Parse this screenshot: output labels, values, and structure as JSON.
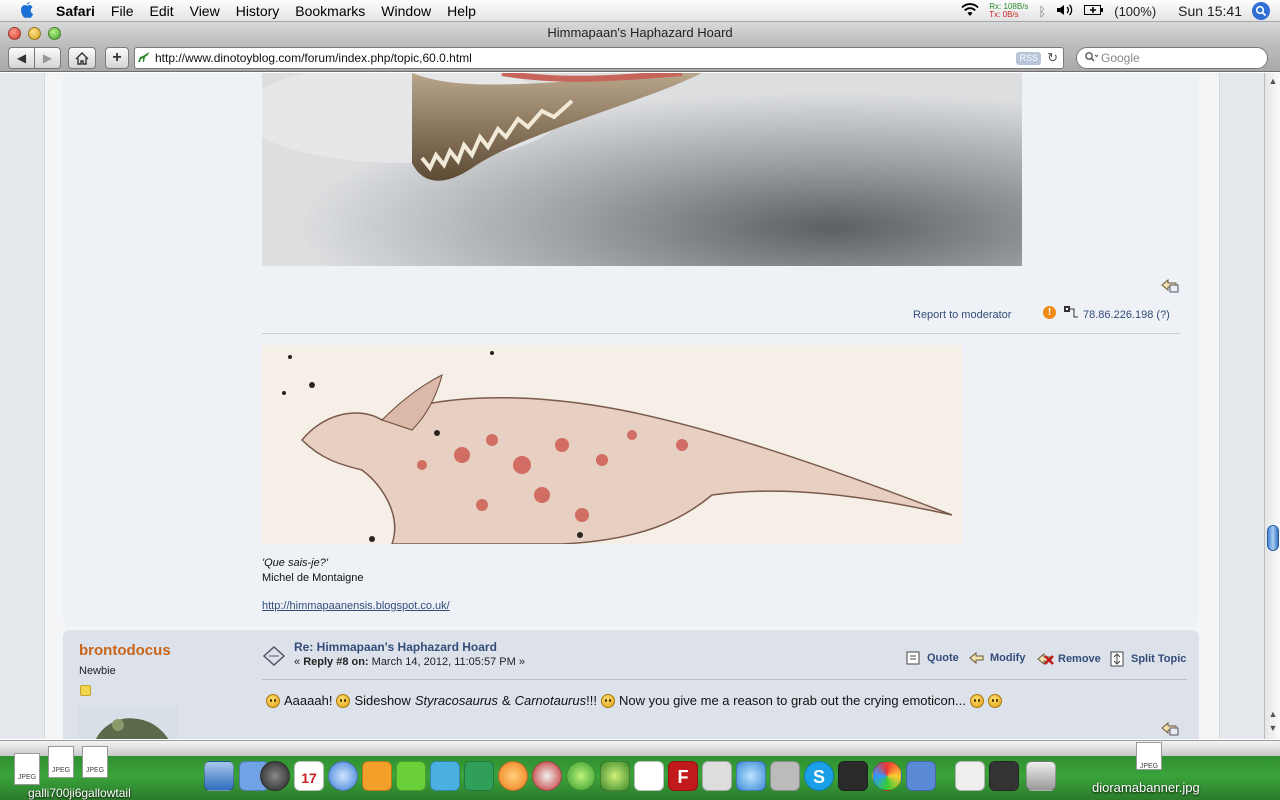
{
  "menubar": {
    "app": "Safari",
    "items": [
      "File",
      "Edit",
      "View",
      "History",
      "Bookmarks",
      "Window",
      "Help"
    ],
    "net_rx_label": "Rx:",
    "net_rx_value": "108B/s",
    "net_tx_label": "Tx:",
    "net_tx_value": "0B/s",
    "battery": "(100%)",
    "clock": "Sun 15:41"
  },
  "window": {
    "title": "Himmapaan's Haphazard Hoard",
    "url": "http://www.dinotoyblog.com/forum/index.php/topic,60.0.html",
    "rss_label": "RSS",
    "search_placeholder": "Google"
  },
  "post1": {
    "report_label": "Report to moderator",
    "ip": "78.86.226.198 (?)",
    "sig_quote": "'Que sais-je?'",
    "sig_author": "Michel de Montaigne",
    "sig_link": "http://himmapaanensis.blogspot.co.uk/"
  },
  "post2": {
    "poster_name": "brontodocus",
    "poster_rank": "Newbie",
    "title": "Re: Himmapaan's Haphazard Hoard",
    "meta_prefix": "« ",
    "meta_reply": "Reply #8 on:",
    "meta_date": " March 14, 2012, 11:05:57 PM »",
    "actions": [
      "Quote",
      "Modify",
      "Remove",
      "Split Topic"
    ],
    "body_part1": "Aaaaah!",
    "body_part2": "Sideshow",
    "body_species1": "Styracosaurus",
    "body_amp": "&",
    "body_species2": "Carnotaurus",
    "body_part3": "!!!",
    "body_part4": "Now you give me a reason to grab out the crying emoticon..."
  },
  "dock": {
    "file_label": "JPEG",
    "left_label": "galli700ji6gallowtail",
    "right_label": "dioramabanner.jpg"
  },
  "colors": {
    "accent_link": "#334d7a",
    "poster_name": "#c8651a",
    "dock_green": "#3aa33a"
  }
}
